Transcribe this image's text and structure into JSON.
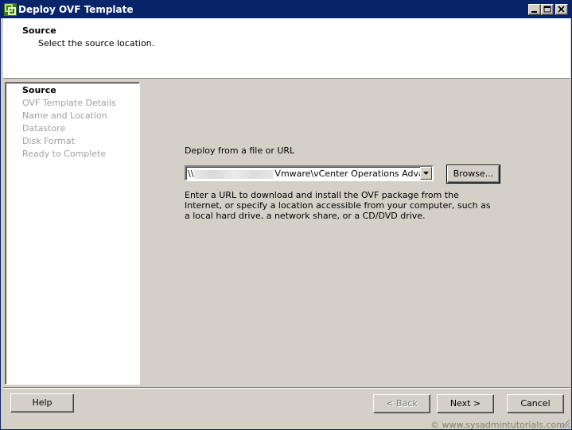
{
  "window": {
    "title": "Deploy OVF Template"
  },
  "header": {
    "title": "Source",
    "subtitle": "Select the source location."
  },
  "nav": {
    "items": [
      {
        "label": "Source",
        "active": true
      },
      {
        "label": "OVF Template Details",
        "active": false
      },
      {
        "label": "Name and Location",
        "active": false
      },
      {
        "label": "Datastore",
        "active": false
      },
      {
        "label": "Disk Format",
        "active": false
      },
      {
        "label": "Ready to Complete",
        "active": false
      }
    ]
  },
  "main": {
    "deploy_label": "Deploy from a file or URL",
    "path_prefix": "\\\\",
    "path_suffix": "Vmware\\vCenter Operations Advanced",
    "browse_label": "Browse...",
    "help_text": "Enter a URL to download and install the OVF package from the Internet, or specify a location accessible from your computer, such as a local hard drive, a network share, or a CD/DVD drive."
  },
  "footer": {
    "help_label": "Help",
    "back_label": "< Back",
    "next_label": "Next >",
    "cancel_label": "Cancel"
  },
  "watermark": "© www.sysadmintutorials.com",
  "colors": {
    "titlebar": "#0a246a",
    "face": "#d4d0c8",
    "disabled_text": "#a0a0a0"
  }
}
